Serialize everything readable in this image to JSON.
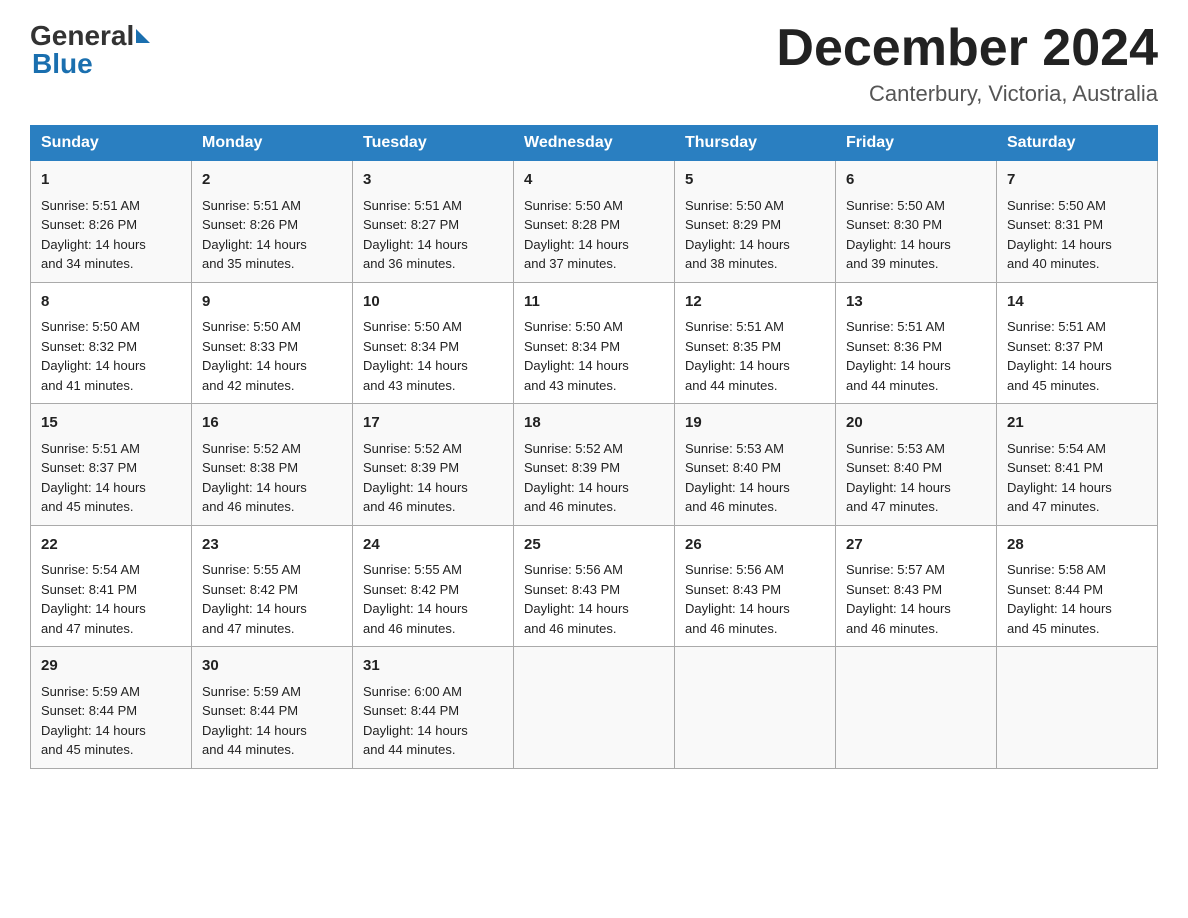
{
  "header": {
    "logo_general": "General",
    "logo_blue": "Blue",
    "month_title": "December 2024",
    "location": "Canterbury, Victoria, Australia"
  },
  "weekdays": [
    "Sunday",
    "Monday",
    "Tuesday",
    "Wednesday",
    "Thursday",
    "Friday",
    "Saturday"
  ],
  "weeks": [
    [
      {
        "day": "1",
        "sunrise": "5:51 AM",
        "sunset": "8:26 PM",
        "daylight": "14 hours and 34 minutes."
      },
      {
        "day": "2",
        "sunrise": "5:51 AM",
        "sunset": "8:26 PM",
        "daylight": "14 hours and 35 minutes."
      },
      {
        "day": "3",
        "sunrise": "5:51 AM",
        "sunset": "8:27 PM",
        "daylight": "14 hours and 36 minutes."
      },
      {
        "day": "4",
        "sunrise": "5:50 AM",
        "sunset": "8:28 PM",
        "daylight": "14 hours and 37 minutes."
      },
      {
        "day": "5",
        "sunrise": "5:50 AM",
        "sunset": "8:29 PM",
        "daylight": "14 hours and 38 minutes."
      },
      {
        "day": "6",
        "sunrise": "5:50 AM",
        "sunset": "8:30 PM",
        "daylight": "14 hours and 39 minutes."
      },
      {
        "day": "7",
        "sunrise": "5:50 AM",
        "sunset": "8:31 PM",
        "daylight": "14 hours and 40 minutes."
      }
    ],
    [
      {
        "day": "8",
        "sunrise": "5:50 AM",
        "sunset": "8:32 PM",
        "daylight": "14 hours and 41 minutes."
      },
      {
        "day": "9",
        "sunrise": "5:50 AM",
        "sunset": "8:33 PM",
        "daylight": "14 hours and 42 minutes."
      },
      {
        "day": "10",
        "sunrise": "5:50 AM",
        "sunset": "8:34 PM",
        "daylight": "14 hours and 43 minutes."
      },
      {
        "day": "11",
        "sunrise": "5:50 AM",
        "sunset": "8:34 PM",
        "daylight": "14 hours and 43 minutes."
      },
      {
        "day": "12",
        "sunrise": "5:51 AM",
        "sunset": "8:35 PM",
        "daylight": "14 hours and 44 minutes."
      },
      {
        "day": "13",
        "sunrise": "5:51 AM",
        "sunset": "8:36 PM",
        "daylight": "14 hours and 44 minutes."
      },
      {
        "day": "14",
        "sunrise": "5:51 AM",
        "sunset": "8:37 PM",
        "daylight": "14 hours and 45 minutes."
      }
    ],
    [
      {
        "day": "15",
        "sunrise": "5:51 AM",
        "sunset": "8:37 PM",
        "daylight": "14 hours and 45 minutes."
      },
      {
        "day": "16",
        "sunrise": "5:52 AM",
        "sunset": "8:38 PM",
        "daylight": "14 hours and 46 minutes."
      },
      {
        "day": "17",
        "sunrise": "5:52 AM",
        "sunset": "8:39 PM",
        "daylight": "14 hours and 46 minutes."
      },
      {
        "day": "18",
        "sunrise": "5:52 AM",
        "sunset": "8:39 PM",
        "daylight": "14 hours and 46 minutes."
      },
      {
        "day": "19",
        "sunrise": "5:53 AM",
        "sunset": "8:40 PM",
        "daylight": "14 hours and 46 minutes."
      },
      {
        "day": "20",
        "sunrise": "5:53 AM",
        "sunset": "8:40 PM",
        "daylight": "14 hours and 47 minutes."
      },
      {
        "day": "21",
        "sunrise": "5:54 AM",
        "sunset": "8:41 PM",
        "daylight": "14 hours and 47 minutes."
      }
    ],
    [
      {
        "day": "22",
        "sunrise": "5:54 AM",
        "sunset": "8:41 PM",
        "daylight": "14 hours and 47 minutes."
      },
      {
        "day": "23",
        "sunrise": "5:55 AM",
        "sunset": "8:42 PM",
        "daylight": "14 hours and 47 minutes."
      },
      {
        "day": "24",
        "sunrise": "5:55 AM",
        "sunset": "8:42 PM",
        "daylight": "14 hours and 46 minutes."
      },
      {
        "day": "25",
        "sunrise": "5:56 AM",
        "sunset": "8:43 PM",
        "daylight": "14 hours and 46 minutes."
      },
      {
        "day": "26",
        "sunrise": "5:56 AM",
        "sunset": "8:43 PM",
        "daylight": "14 hours and 46 minutes."
      },
      {
        "day": "27",
        "sunrise": "5:57 AM",
        "sunset": "8:43 PM",
        "daylight": "14 hours and 46 minutes."
      },
      {
        "day": "28",
        "sunrise": "5:58 AM",
        "sunset": "8:44 PM",
        "daylight": "14 hours and 45 minutes."
      }
    ],
    [
      {
        "day": "29",
        "sunrise": "5:59 AM",
        "sunset": "8:44 PM",
        "daylight": "14 hours and 45 minutes."
      },
      {
        "day": "30",
        "sunrise": "5:59 AM",
        "sunset": "8:44 PM",
        "daylight": "14 hours and 44 minutes."
      },
      {
        "day": "31",
        "sunrise": "6:00 AM",
        "sunset": "8:44 PM",
        "daylight": "14 hours and 44 minutes."
      },
      null,
      null,
      null,
      null
    ]
  ],
  "labels": {
    "sunrise": "Sunrise:",
    "sunset": "Sunset:",
    "daylight": "Daylight:"
  }
}
